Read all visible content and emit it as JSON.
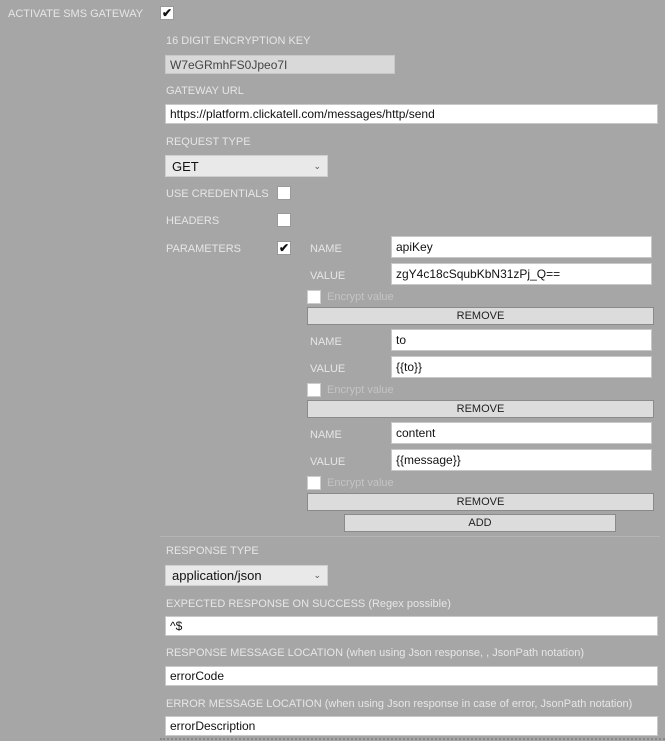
{
  "activate": {
    "label": "ACTIVATE SMS GATEWAY",
    "checked": true
  },
  "key": {
    "label": "16 DIGIT ENCRYPTION KEY",
    "value": "W7eGRmhFS0Jpeo7I"
  },
  "url": {
    "label": "GATEWAY URL",
    "value": "https://platform.clickatell.com/messages/http/send"
  },
  "request_type": {
    "label": "REQUEST TYPE",
    "value": "GET"
  },
  "use_credentials": {
    "label": "USE CREDENTIALS",
    "checked": false
  },
  "headers": {
    "label": "HEADERS",
    "checked": false
  },
  "parameters": {
    "label": "PARAMETERS",
    "checked": true,
    "name_label": "NAME",
    "value_label": "VALUE",
    "encrypt_label": "Encrypt value",
    "remove_label": "REMOVE",
    "add_label": "ADD",
    "items": [
      {
        "name": "apiKey",
        "value": "zgY4c18cSqubKbN31zPj_Q=="
      },
      {
        "name": "to",
        "value": "{{to}}"
      },
      {
        "name": "content",
        "value": "{{message}}"
      }
    ]
  },
  "response_type": {
    "label": "RESPONSE TYPE",
    "value": "application/json"
  },
  "expected": {
    "label": "EXPECTED RESPONSE ON SUCCESS (Regex possible)",
    "value": "^$"
  },
  "response_loc": {
    "label": "RESPONSE MESSAGE LOCATION (when using Json response, , JsonPath notation)",
    "value": "errorCode"
  },
  "error_loc": {
    "label": "ERROR MESSAGE LOCATION (when using Json response in case of error, JsonPath notation)",
    "value": "errorDescription"
  },
  "icons": {
    "check": "✔",
    "chevron": "⌄"
  }
}
